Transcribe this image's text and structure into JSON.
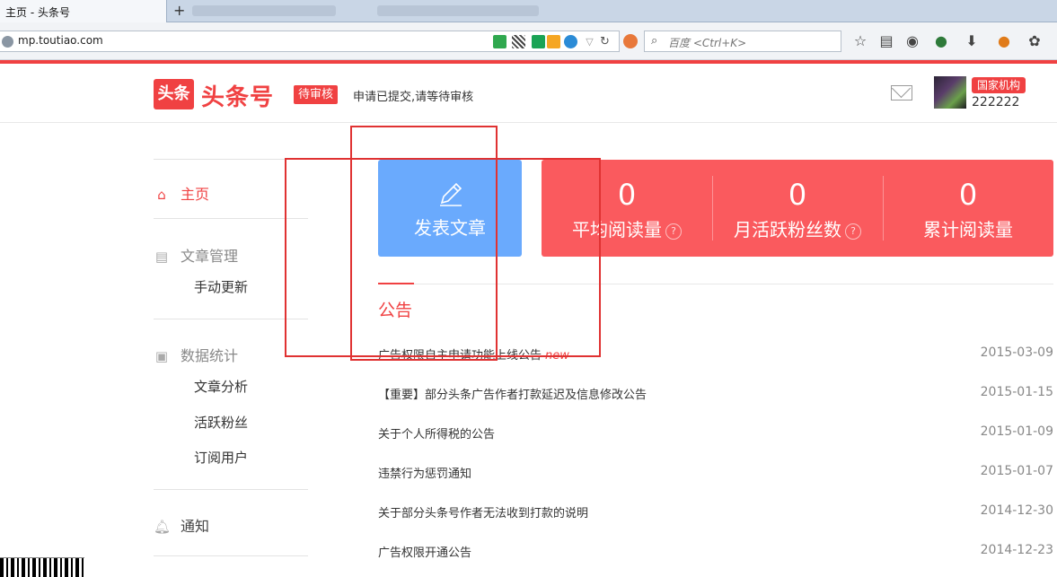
{
  "browser": {
    "tab_title": "主页 - 头条号",
    "new_tab_symbol": "+",
    "url": "mp.toutiao.com",
    "search_placeholder": "百度 <Ctrl+K>",
    "bar_color": "#f04142"
  },
  "header": {
    "logo_badge": "头条",
    "logo_text": "头条号",
    "status_badge": "待审核",
    "status_message": "申请已提交,请等待审核",
    "org_badge": "国家机构",
    "username": "222222"
  },
  "sidebar": {
    "home": "主页",
    "article_mgmt": "文章管理",
    "manual_update": "手动更新",
    "data_stats": "数据统计",
    "article_analysis": "文章分析",
    "active_fans": "活跃粉丝",
    "subscribers": "订阅用户",
    "notifications": "通知"
  },
  "main": {
    "post_button": "发表文章",
    "stats": [
      {
        "value": "0",
        "label": "平均阅读量",
        "help": "?"
      },
      {
        "value": "0",
        "label": "月活跃粉丝数",
        "help": "?"
      },
      {
        "value": "0",
        "label": "累计阅读量",
        "help": ""
      }
    ],
    "notice_title": "公告",
    "notices": [
      {
        "text": "广告权限自主申请功能上线公告",
        "tag": "new",
        "date": "2015-03-09"
      },
      {
        "text": "【重要】部分头条广告作者打款延迟及信息修改公告",
        "tag": "",
        "date": "2015-01-15"
      },
      {
        "text": "关于个人所得税的公告",
        "tag": "",
        "date": "2015-01-09"
      },
      {
        "text": "违禁行为惩罚通知",
        "tag": "",
        "date": "2015-01-07"
      },
      {
        "text": "关于部分头条号作者无法收到打款的说明",
        "tag": "",
        "date": "2014-12-30"
      },
      {
        "text": "广告权限开通公告",
        "tag": "",
        "date": "2014-12-23"
      }
    ]
  }
}
